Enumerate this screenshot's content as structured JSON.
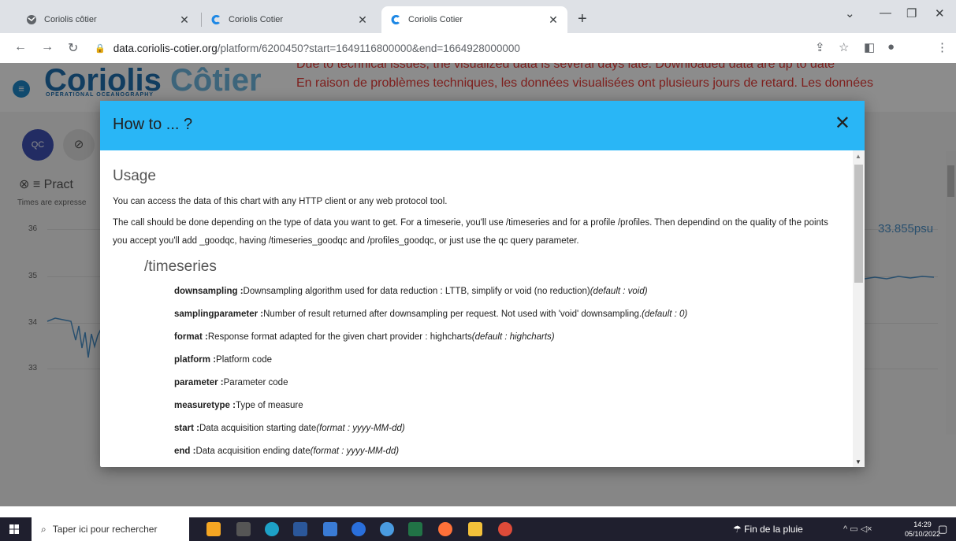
{
  "browser": {
    "tabs": [
      {
        "title": "Coriolis côtier",
        "active": false
      },
      {
        "title": "Coriolis Cotier",
        "active": false
      },
      {
        "title": "Coriolis Cotier",
        "active": true
      }
    ],
    "url_host": "data.coriolis-cotier.org",
    "url_path": "/platform/6200450?start=1649116800000&end=1664928000000"
  },
  "site": {
    "logo_main": "Coriolis",
    "logo_accent": "Côtier",
    "logo_sub": "OPERATIONAL OCEANOGRAPHY",
    "banner_en": "Due to technical issues, the visualized data is several days late. Downloaded data are up to date",
    "banner_fr": "En raison de problèmes techniques, les données visualisées ont plusieurs jours de retard. Les données",
    "qc_label": "QC",
    "chart_title": "Pract",
    "times_note": "Times are expresse",
    "y_ticks": [
      "36",
      "35",
      "34",
      "33"
    ],
    "last_value": "33.855psu"
  },
  "dialog": {
    "title": "How to ... ?",
    "usage_heading": "Usage",
    "p1": "You can access the data of this chart with any HTTP client or any web protocol tool.",
    "p2": "The call should be done depending on the type of data you want to get. For a timeserie, you'll use /timeseries and for a profile /profiles. Then dependind on the quality of the points you accept you'll add _goodqc, having /timeseries_goodqc and /profiles_goodqc, or just use the qc query parameter.",
    "timeseries_heading": "/timeseries",
    "params": [
      {
        "name": "downsampling :",
        "desc": "Downsampling algorithm used for data reduction : LTTB, simplify or void (no reduction)",
        "note": "(default : void)"
      },
      {
        "name": "samplingparameter :",
        "desc": "Number of result returned after downsampling per request. Not used with 'void' downsampling.",
        "note": "(default : 0)"
      },
      {
        "name": "format :",
        "desc": "Response format adapted for the given chart provider : highcharts",
        "note": "(default : highcharts)"
      },
      {
        "name": "platform :",
        "desc": "Platform code",
        "note": ""
      },
      {
        "name": "parameter :",
        "desc": "Parameter code",
        "note": ""
      },
      {
        "name": "measuretype :",
        "desc": "Type of measure",
        "note": ""
      },
      {
        "name": "start :",
        "desc": "Data acquisition starting date",
        "note": "(format : yyyy-MM-dd)"
      },
      {
        "name": "end :",
        "desc": "Data acquisition ending date",
        "note": "(format : yyyy-MM-dd)"
      }
    ]
  },
  "taskbar": {
    "search_placeholder": "Taper ici pour rechercher",
    "weather": "Fin de la pluie",
    "time": "14:29",
    "date": "05/10/2022"
  },
  "colors": {
    "dialog_header": "#29b6f6",
    "banner_text": "#e53935",
    "logo_blue": "#1f6fb0"
  }
}
